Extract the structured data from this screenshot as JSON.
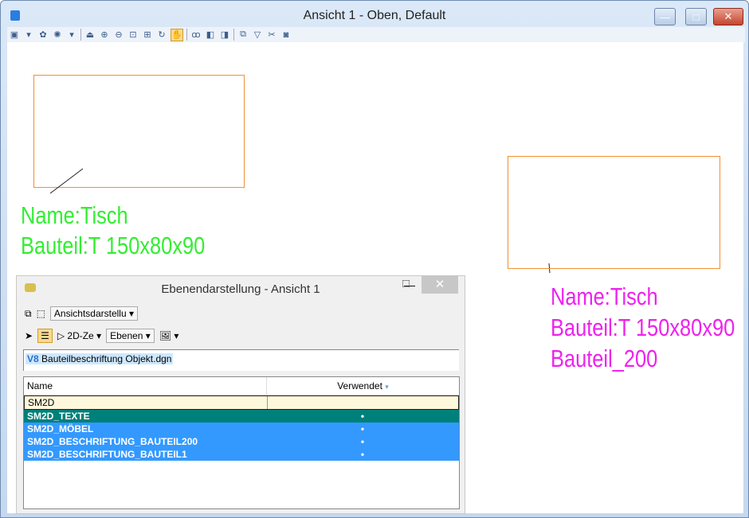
{
  "window": {
    "title": "Ansicht 1 - Oben, Default",
    "minimize": "—",
    "maximize": "□",
    "close": "✕"
  },
  "drawing": {
    "left_label": [
      "Name:Tisch",
      "Bauteil:T 150x80x90"
    ],
    "right_label": [
      "Name:Tisch",
      "Bauteil:T 150x80x90",
      "Bauteil_200"
    ],
    "colors": {
      "left": "#33ee33",
      "right": "#ee22ee",
      "outline": "#f09030"
    }
  },
  "dialog": {
    "title": "Ebenendarstellung - Ansicht 1",
    "minimize": "—",
    "maximize": "□",
    "close": "✕",
    "view_mode": "Ansichtsdarstellu",
    "mode_2d": "2D-Ze",
    "filter": "Ebenen",
    "file": "Bauteilbeschriftung Objekt.dgn",
    "columns": [
      "Name",
      "Verwendet"
    ],
    "filter_row": "SM2D",
    "rows": [
      {
        "name": "SM2D_TEXTE",
        "used": "•"
      },
      {
        "name": "SM2D_MÖBEL",
        "used": "•"
      },
      {
        "name": "SM2D_BESCHRIFTUNG_BAUTEIL200",
        "used": "•"
      },
      {
        "name": "SM2D_BESCHRIFTUNG_BAUTEIL1",
        "used": "•"
      }
    ]
  }
}
